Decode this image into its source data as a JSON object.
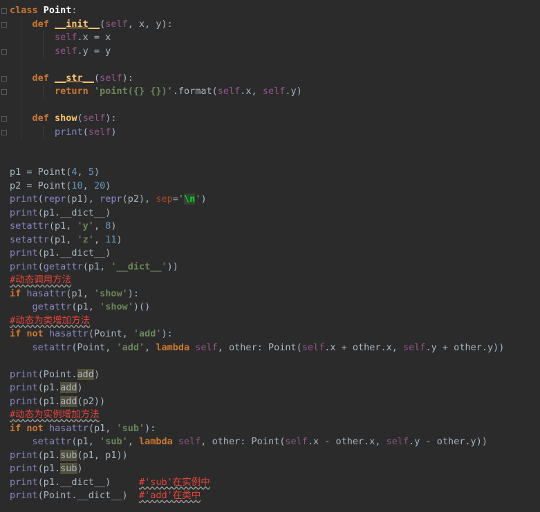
{
  "editor": {
    "language": "python",
    "lines": [
      "class Point:",
      "    def __init__(self, x, y):",
      "        self.x = x",
      "        self.y = y",
      "",
      "    def __str__(self):",
      "        return 'point({} {})'.format(self.x, self.y)",
      "",
      "    def show(self):",
      "        print(self)",
      "",
      "",
      "p1 = Point(4, 5)",
      "p2 = Point(10, 20)",
      "print(repr(p1), repr(p2), sep='\\n')",
      "print(p1.__dict__)",
      "setattr(p1, 'y', 8)",
      "setattr(p1, 'z', 11)",
      "print(p1.__dict__)",
      "print(getattr(p1, '__dict__'))",
      "#动态调用方法",
      "if hasattr(p1, 'show'):",
      "    getattr(p1, 'show')()",
      "#动态为类增加方法",
      "if not hasattr(Point, 'add'):",
      "    setattr(Point, 'add', lambda self, other: Point(self.x + other.x, self.y + other.y))",
      "",
      "print(Point.add)",
      "print(p1.add)",
      "print(p1.add(p2))",
      "#动态为实例增加方法",
      "if not hasattr(p1, 'sub'):",
      "    setattr(p1, 'sub', lambda self, other: Point(self.x - other.x, self.y - other.y))",
      "print(p1.sub(p1, p1))",
      "print(p1.sub)",
      "print(p1.__dict__)     #'sub'在实例中",
      "print(Point.__dict__)  #'add'在类中"
    ]
  },
  "colors": {
    "background": "#2b2b2b",
    "keyword": "#cc7832",
    "function": "#ffc66d",
    "self": "#94558d",
    "number": "#6897bb",
    "string": "#6a8759",
    "builtin": "#8888c6",
    "comment": "#e8453c",
    "text": "#a9b7c6"
  }
}
